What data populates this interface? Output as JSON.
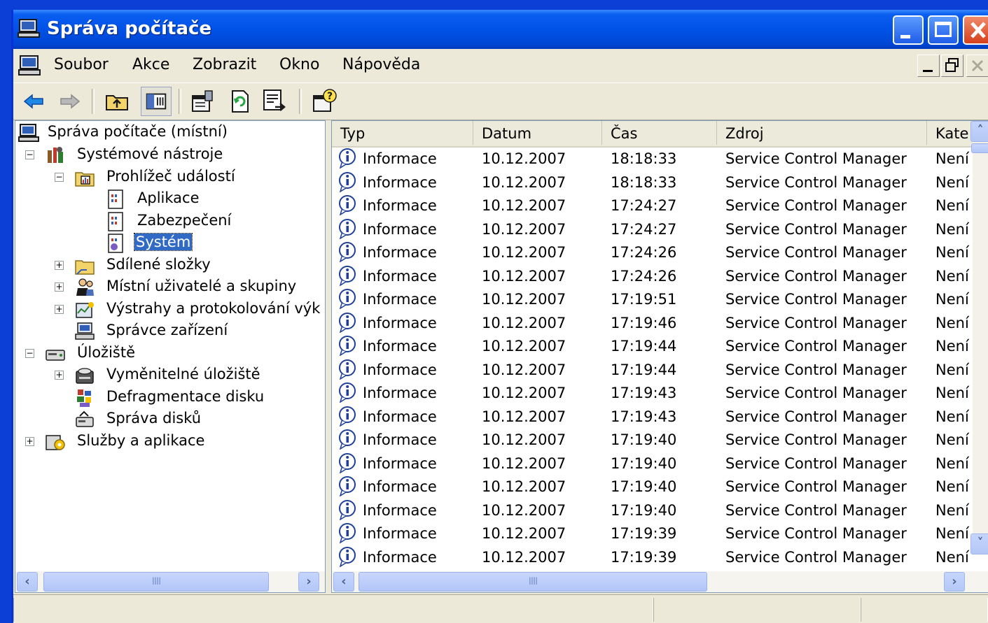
{
  "window": {
    "title": "Správa počítače"
  },
  "menu": {
    "items": [
      "Soubor",
      "Akce",
      "Zobrazit",
      "Okno",
      "Nápověda"
    ]
  },
  "toolbar": {
    "buttons": [
      "back-arrow",
      "forward-arrow",
      "up-folder",
      "show-hide-console-tree",
      "properties",
      "refresh",
      "export-list",
      "help"
    ]
  },
  "tree": {
    "root": "Správa počítače (místní)",
    "items": [
      {
        "label": "Systémové nástroje"
      },
      {
        "label": "Prohlížeč událostí"
      },
      {
        "label": "Aplikace"
      },
      {
        "label": "Zabezpečení"
      },
      {
        "label": "Systém"
      },
      {
        "label": "Sdílené složky"
      },
      {
        "label": "Místní uživatelé a skupiny"
      },
      {
        "label": "Výstrahy a protokolování výk"
      },
      {
        "label": "Správce zařízení"
      },
      {
        "label": "Úložiště"
      },
      {
        "label": "Vyměnitelné úložiště"
      },
      {
        "label": "Defragmentace disku"
      },
      {
        "label": "Správa disků"
      },
      {
        "label": "Služby a aplikace"
      }
    ],
    "selected": "Systém"
  },
  "list": {
    "columns": [
      "Typ",
      "Datum",
      "Čas",
      "Zdroj",
      "Kate"
    ],
    "rows": [
      [
        "Informace",
        "10.12.2007",
        "18:18:33",
        "Service Control Manager",
        "Není"
      ],
      [
        "Informace",
        "10.12.2007",
        "18:18:33",
        "Service Control Manager",
        "Není"
      ],
      [
        "Informace",
        "10.12.2007",
        "17:24:27",
        "Service Control Manager",
        "Není"
      ],
      [
        "Informace",
        "10.12.2007",
        "17:24:27",
        "Service Control Manager",
        "Není"
      ],
      [
        "Informace",
        "10.12.2007",
        "17:24:26",
        "Service Control Manager",
        "Není"
      ],
      [
        "Informace",
        "10.12.2007",
        "17:24:26",
        "Service Control Manager",
        "Není"
      ],
      [
        "Informace",
        "10.12.2007",
        "17:19:51",
        "Service Control Manager",
        "Není"
      ],
      [
        "Informace",
        "10.12.2007",
        "17:19:46",
        "Service Control Manager",
        "Není"
      ],
      [
        "Informace",
        "10.12.2007",
        "17:19:44",
        "Service Control Manager",
        "Není"
      ],
      [
        "Informace",
        "10.12.2007",
        "17:19:44",
        "Service Control Manager",
        "Není"
      ],
      [
        "Informace",
        "10.12.2007",
        "17:19:43",
        "Service Control Manager",
        "Není"
      ],
      [
        "Informace",
        "10.12.2007",
        "17:19:43",
        "Service Control Manager",
        "Není"
      ],
      [
        "Informace",
        "10.12.2007",
        "17:19:40",
        "Service Control Manager",
        "Není"
      ],
      [
        "Informace",
        "10.12.2007",
        "17:19:40",
        "Service Control Manager",
        "Není"
      ],
      [
        "Informace",
        "10.12.2007",
        "17:19:40",
        "Service Control Manager",
        "Není"
      ],
      [
        "Informace",
        "10.12.2007",
        "17:19:40",
        "Service Control Manager",
        "Není"
      ],
      [
        "Informace",
        "10.12.2007",
        "17:19:39",
        "Service Control Manager",
        "Není"
      ],
      [
        "Informace",
        "10.12.2007",
        "17:19:39",
        "Service Control Manager",
        "Není"
      ]
    ]
  },
  "colors": {
    "titlebar": "#0052e6",
    "selection": "#316ac5",
    "face": "#ece9d8"
  }
}
